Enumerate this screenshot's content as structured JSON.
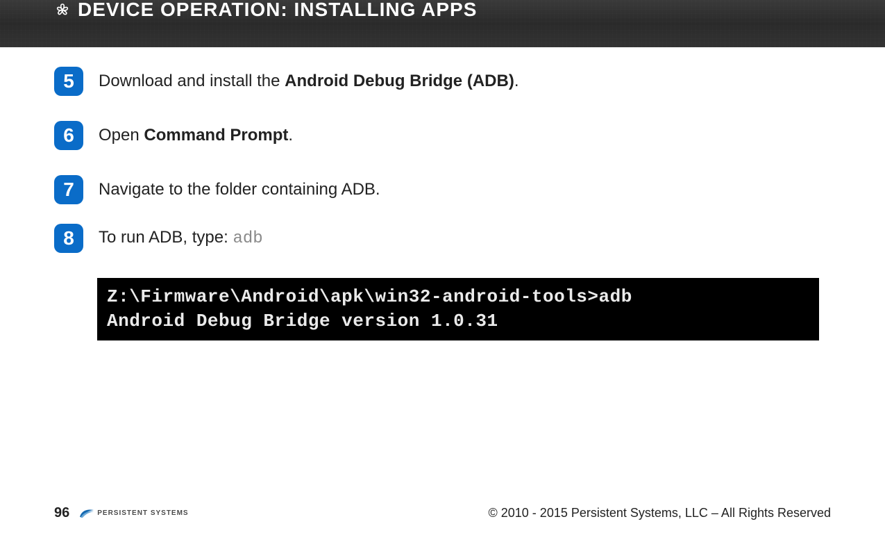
{
  "header": {
    "title_prefix": "DEVICE OPERATION:",
    "title_suffix": "  INSTALLING APPS"
  },
  "steps": [
    {
      "num": "5",
      "segments": [
        {
          "text": "Download and install the ",
          "bold": false
        },
        {
          "text": "Android Debug Bridge (ADB)",
          "bold": true
        },
        {
          "text": ".",
          "bold": false
        }
      ]
    },
    {
      "num": "6",
      "segments": [
        {
          "text": "Open ",
          "bold": false
        },
        {
          "text": "Command Prompt",
          "bold": true
        },
        {
          "text": ".",
          "bold": false
        }
      ]
    },
    {
      "num": "7",
      "segments": [
        {
          "text": "Navigate to the folder containing ADB.",
          "bold": false
        }
      ]
    },
    {
      "num": "8",
      "segments": [
        {
          "text": "To run ADB, type: ",
          "bold": false
        },
        {
          "text": "adb",
          "mono": true
        }
      ]
    }
  ],
  "terminal": {
    "line1": "Z:\\Firmware\\Android\\apk\\win32-android-tools>adb",
    "line2": "Android Debug Bridge version 1.0.31"
  },
  "footer": {
    "page": "96",
    "brand": "PERSISTENT SYSTEMS",
    "copyright": "© 2010 - 2015 Persistent Systems, LLC – All Rights Reserved"
  }
}
